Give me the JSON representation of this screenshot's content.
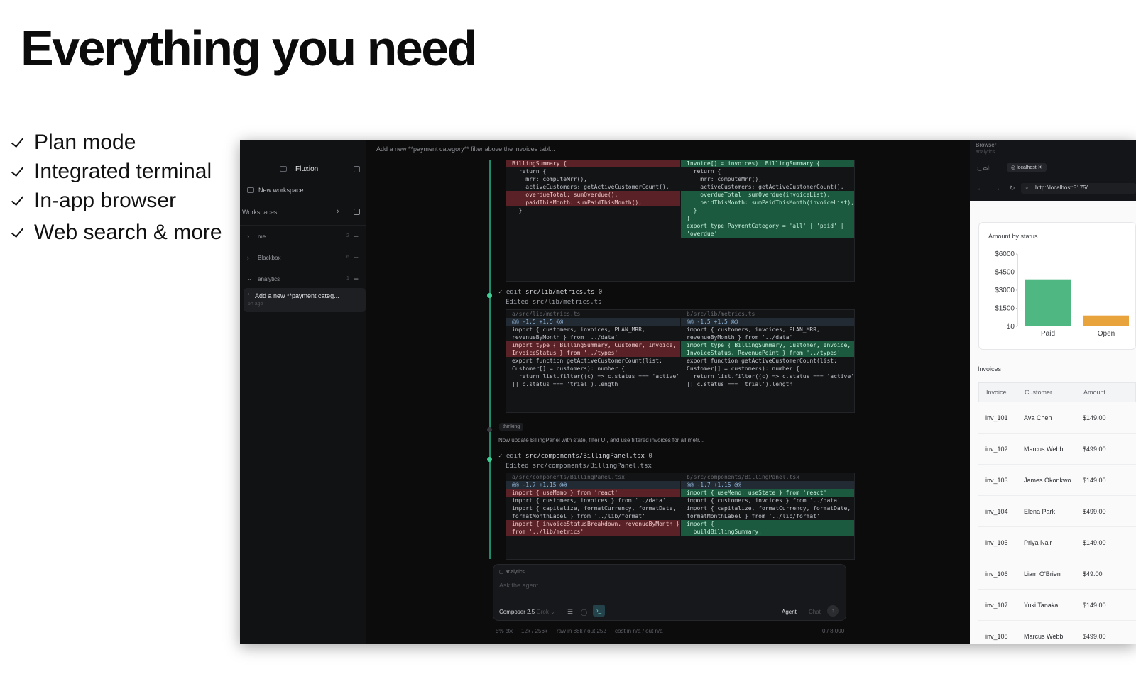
{
  "headline": "Everything you need",
  "features": [
    "Plan mode",
    "Integrated terminal",
    "In-app browser",
    "Web search & more"
  ],
  "app": {
    "name": "Fluxion",
    "prompt_title": "Add a new **payment category** filter above the invoices tabl...",
    "sidebar": {
      "new_workspace": "New workspace",
      "workspaces_label": "Workspaces",
      "groups": [
        {
          "name": "me",
          "count": "2"
        },
        {
          "name": "Blackbox",
          "count": "6"
        },
        {
          "name": "analytics",
          "count": "1"
        }
      ],
      "active_thread": {
        "title": "Add a new **payment categ...",
        "time": "5h ago"
      }
    },
    "diff1": {
      "left": [
        "BillingSummary {",
        "  return {",
        "    mrr: computeMrr(),",
        "    activeCustomers: getActiveCustomerCount(),",
        "    overdueTotal: sumOverdue(),",
        "    paidThisMonth: sumPaidThisMonth(),",
        "",
        "",
        "  }"
      ],
      "right": [
        "Invoice[] = invoices): BillingSummary {",
        "  return {",
        "    mrr: computeMrr(),",
        "    activeCustomers: getActiveCustomerCount(),",
        "",
        "    overdueTotal: sumOverdue(invoiceList),",
        "    paidThisMonth: sumPaidThisMonth(invoiceList),",
        "  }",
        "}",
        "",
        "export type PaymentCategory = 'all' | 'paid' |",
        "'overdue'",
        ""
      ]
    },
    "edit1": {
      "verb": "edit",
      "file": "src/lib/metrics.ts",
      "marker": "0",
      "note": "Edited src/lib/metrics.ts"
    },
    "diff2": {
      "left_head": "a/src/lib/metrics.ts",
      "right_head": "b/src/lib/metrics.ts",
      "hunk": "@@ -1,5 +1,5 @@",
      "left": [
        "import { customers, invoices, PLAN_MRR,",
        "revenueByMonth } from '../data'",
        "import type { BillingSummary, Customer, Invoice,",
        "InvoiceStatus } from '../types'",
        "",
        "export function getActiveCustomerCount(list:",
        "Customer[] = customers): number {",
        "  return list.filter((c) => c.status === 'active'",
        "|| c.status === 'trial').length"
      ],
      "right": [
        "import { customers, invoices, PLAN_MRR,",
        "revenueByMonth } from '../data'",
        "import type { BillingSummary, Customer, Invoice,",
        "InvoiceStatus, RevenuePoint } from '../types'",
        "",
        "export function getActiveCustomerCount(list:",
        "Customer[] = customers): number {",
        "  return list.filter((c) => c.status === 'active'",
        "|| c.status === 'trial').length"
      ]
    },
    "thinking": {
      "label": "thinking",
      "text": "Now update BillingPanel with state, filter UI, and use filtered invoices for all metr..."
    },
    "edit2": {
      "verb": "edit",
      "file": "src/components/BillingPanel.tsx",
      "marker": "0",
      "note": "Edited src/components/BillingPanel.tsx"
    },
    "diff3": {
      "left_head": "a/src/components/BillingPanel.tsx",
      "right_head": "b/src/components/BillingPanel.tsx",
      "hunk": "@@ -1,7 +1,15 @@",
      "left": [
        "import { useMemo } from 'react'",
        "import { customers, invoices } from '../data'",
        "import { capitalize, formatCurrency, formatDate,",
        "formatMonthLabel } from '../lib/format'",
        "import { invoiceStatusBreakdown, revenueByMonth }",
        "from '../lib/metrics'"
      ],
      "right": [
        "import { useMemo, useState } from 'react'",
        "import { customers, invoices } from '../data'",
        "import { capitalize, formatCurrency, formatDate,",
        "formatMonthLabel } from '../lib/format'",
        "import {",
        "",
        "  buildBillingSummary,"
      ]
    },
    "composer": {
      "context_chip": "analytics",
      "placeholder": "Ask the agent...",
      "model": "Composer 2.5",
      "model_sub": "Grok",
      "mode_agent": "Agent",
      "mode_chat": "Chat"
    },
    "status": {
      "ctx": "5% ctx",
      "tokens": "12k / 256k",
      "raw": "raw in 88k / out 252",
      "cost": "cost in n/a / out n/a",
      "chars": "0 / 8,000"
    },
    "browser": {
      "title": "Browser",
      "subtitle": "analytics",
      "tab_terminal": "zsh",
      "tab_local": "localhost",
      "url": "http://localhost:5175/",
      "chart_title": "Amount by status",
      "invoices_title": "Invoices",
      "columns": [
        "Invoice",
        "Customer",
        "Amount"
      ],
      "rows": [
        [
          "inv_101",
          "Ava Chen",
          "$149.00"
        ],
        [
          "inv_102",
          "Marcus Webb",
          "$499.00"
        ],
        [
          "inv_103",
          "James Okonkwo",
          "$149.00"
        ],
        [
          "inv_104",
          "Elena Park",
          "$499.00"
        ],
        [
          "inv_105",
          "Priya Nair",
          "$149.00"
        ],
        [
          "inv_106",
          "Liam O'Brien",
          "$49.00"
        ],
        [
          "inv_107",
          "Yuki Tanaka",
          "$149.00"
        ],
        [
          "inv_108",
          "Marcus Webb",
          "$499.00"
        ]
      ]
    }
  },
  "chart_data": {
    "type": "bar",
    "title": "Amount by status",
    "categories": [
      "Paid",
      "Open"
    ],
    "values": [
      3900,
      900
    ],
    "y_tick_labels": [
      "$0",
      "$1500",
      "$3000",
      "$4500",
      "$6000"
    ],
    "ylim": [
      0,
      6000
    ],
    "colors": [
      "#4fb882",
      "#e8a33d"
    ]
  }
}
